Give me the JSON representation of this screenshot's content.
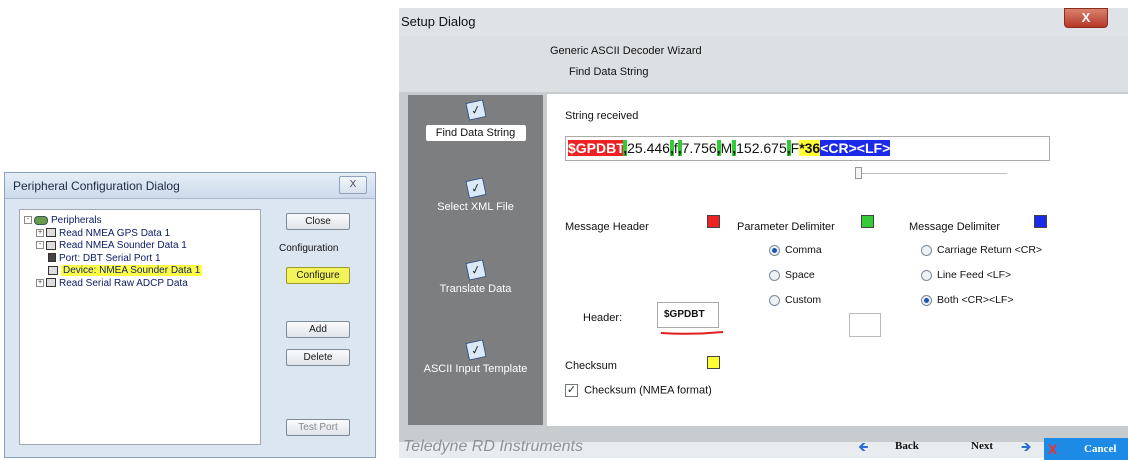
{
  "peripheral_dialog": {
    "title": "Peripheral Configuration Dialog",
    "close_glyph": "X",
    "tree": [
      {
        "label": "Peripherals",
        "expander": "-",
        "indent": 0
      },
      {
        "label": "Read NMEA GPS Data 1",
        "expander": "+",
        "indent": 1
      },
      {
        "label": "Read NMEA Sounder Data 1",
        "expander": "-",
        "indent": 1
      },
      {
        "label": "Port: DBT Serial Port 1",
        "expander": "",
        "indent": 2
      },
      {
        "label": "Device: NMEA Sounder Data 1",
        "expander": "",
        "indent": 2,
        "highlighted": true
      },
      {
        "label": "Read Serial Raw ADCP Data",
        "expander": "+",
        "indent": 1
      }
    ],
    "buttons": {
      "close": "Close",
      "configuration_label": "Configuration",
      "configure": "Configure",
      "add": "Add",
      "delete": "Delete",
      "test_port": "Test Port"
    },
    "highlight_color": "#ffff44"
  },
  "setup_dialog": {
    "title": "Setup Dialog",
    "close_glyph": "X",
    "wizard_title": "Generic ASCII Decoder Wizard",
    "step_title": "Find Data String",
    "nav": [
      {
        "label": "Find Data String",
        "active": true,
        "icon": "checklist-icon"
      },
      {
        "label": "Select XML File",
        "active": false,
        "icon": "checklist-icon"
      },
      {
        "label": "Translate Data",
        "active": false,
        "icon": "checklist-icon"
      },
      {
        "label": "ASCII Input Template",
        "active": false,
        "icon": "checklist-icon"
      }
    ],
    "string_received_label": "String received",
    "string_segments": [
      {
        "text": "$GPDBT",
        "style": "red"
      },
      {
        "text": ",",
        "style": "green"
      },
      {
        "text": "25.446",
        "style": "plain"
      },
      {
        "text": ",",
        "style": "green"
      },
      {
        "text": "f",
        "style": "plain"
      },
      {
        "text": ",",
        "style": "green"
      },
      {
        "text": "7.756",
        "style": "plain"
      },
      {
        "text": ",",
        "style": "green"
      },
      {
        "text": "M",
        "style": "plain"
      },
      {
        "text": ",",
        "style": "green"
      },
      {
        "text": "152.675",
        "style": "plain"
      },
      {
        "text": ",",
        "style": "green"
      },
      {
        "text": "F",
        "style": "plain"
      },
      {
        "text": "*36",
        "style": "yellow"
      },
      {
        "text": "<CR><LF>",
        "style": "blue"
      }
    ],
    "message_header": {
      "label": "Message Header",
      "color": "#ee2222"
    },
    "parameter_delimiter": {
      "label": "Parameter Delimiter",
      "color": "#34cc34",
      "options": [
        {
          "label": "Comma",
          "selected": true
        },
        {
          "label": "Space",
          "selected": false
        },
        {
          "label": "Custom",
          "selected": false
        }
      ]
    },
    "message_delimiter": {
      "label": "Message Delimiter",
      "color": "#1a2ae8",
      "options": [
        {
          "label": "Carriage Return <CR>",
          "selected": false
        },
        {
          "label": "Line Feed <LF>",
          "selected": false
        },
        {
          "label": "Both <CR><LF>",
          "selected": true
        }
      ]
    },
    "header": {
      "label": "Header:",
      "value": "$GPDBT"
    },
    "checksum": {
      "label": "Checksum",
      "color": "#ffff33",
      "checkbox_label": "Checksum (NMEA format)",
      "checked": true,
      "check_glyph": "✓"
    },
    "footer": {
      "brand": "Teledyne RD Instruments",
      "back": "Back",
      "next": "Next",
      "cancel": "Cancel",
      "cancel_glyph": "X",
      "back_arrow_glyph": "🡸",
      "next_arrow_glyph": "🡺"
    }
  }
}
